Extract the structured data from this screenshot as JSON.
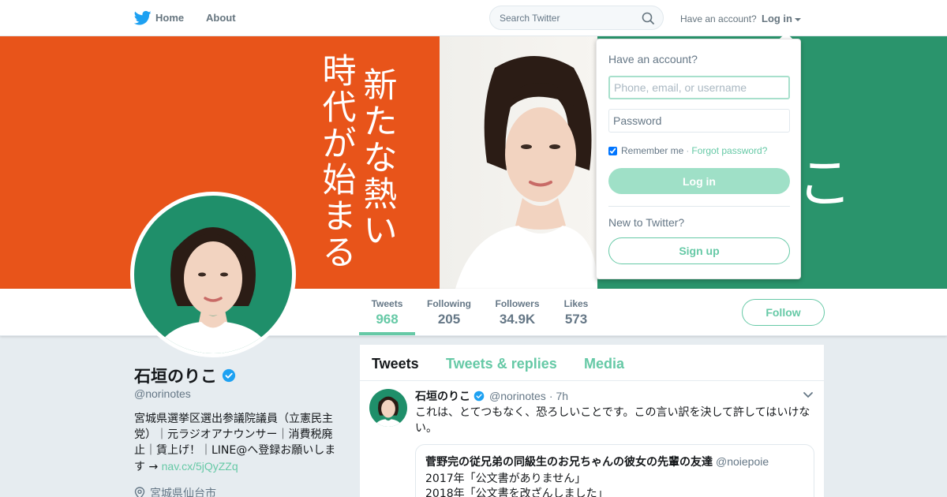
{
  "colors": {
    "accent": "#66c9a6",
    "banner_left": "#e8541a",
    "banner_right": "#2a946c",
    "verified": "#1da1f2",
    "twitter_blue": "#1da1f2"
  },
  "topnav": {
    "logo_icon": "twitter-bird-icon",
    "home_label": "Home",
    "about_label": "About",
    "search_placeholder": "Search Twitter",
    "search_icon": "search-icon",
    "have_account": "Have an account?",
    "login_label": "Log in"
  },
  "banner": {
    "line1": "新たな熱い",
    "line2": "時代が始まる",
    "partial_glyph": "こ"
  },
  "profile_nav": {
    "stats": [
      {
        "label": "Tweets",
        "value": "968",
        "active": true
      },
      {
        "label": "Following",
        "value": "205"
      },
      {
        "label": "Followers",
        "value": "34.9K"
      },
      {
        "label": "Likes",
        "value": "573"
      }
    ],
    "follow_label": "Follow"
  },
  "profile": {
    "name": "石垣のりこ",
    "handle": "@norinotes",
    "bio": "宮城県選挙区選出参議院議員（立憲民主党）｜元ラジオアナウンサー｜消費税廃止｜賃上げ！｜LINE@へ登録お願いします →",
    "bio_link": "nav.cx/5jQyZZq",
    "location": "宮城県仙台市"
  },
  "timeline": {
    "tabs": [
      "Tweets",
      "Tweets & replies",
      "Media"
    ],
    "tweet": {
      "name": "石垣のりこ",
      "handle": "@norinotes",
      "dot": "·",
      "time": "7h",
      "text": "これは、とてつもなく、恐ろしいことです。この言い訳を決して許してはいけない。",
      "quote": {
        "name": "菅野完の従兄弟の同級生のお兄ちゃんの彼女の先輩の友達",
        "handle": "@noiepoie",
        "line1": "2017年「公文書がありません」",
        "line2": "2018年「公文書を改ざんしました」"
      }
    }
  },
  "login_dropdown": {
    "title": "Have an account?",
    "username_placeholder": "Phone, email, or username",
    "password_placeholder": "Password",
    "remember_label": "Remember me",
    "separator": "·",
    "forgot_label": "Forgot password?",
    "login_button": "Log in",
    "new_label": "New to Twitter?",
    "signup_button": "Sign up"
  }
}
